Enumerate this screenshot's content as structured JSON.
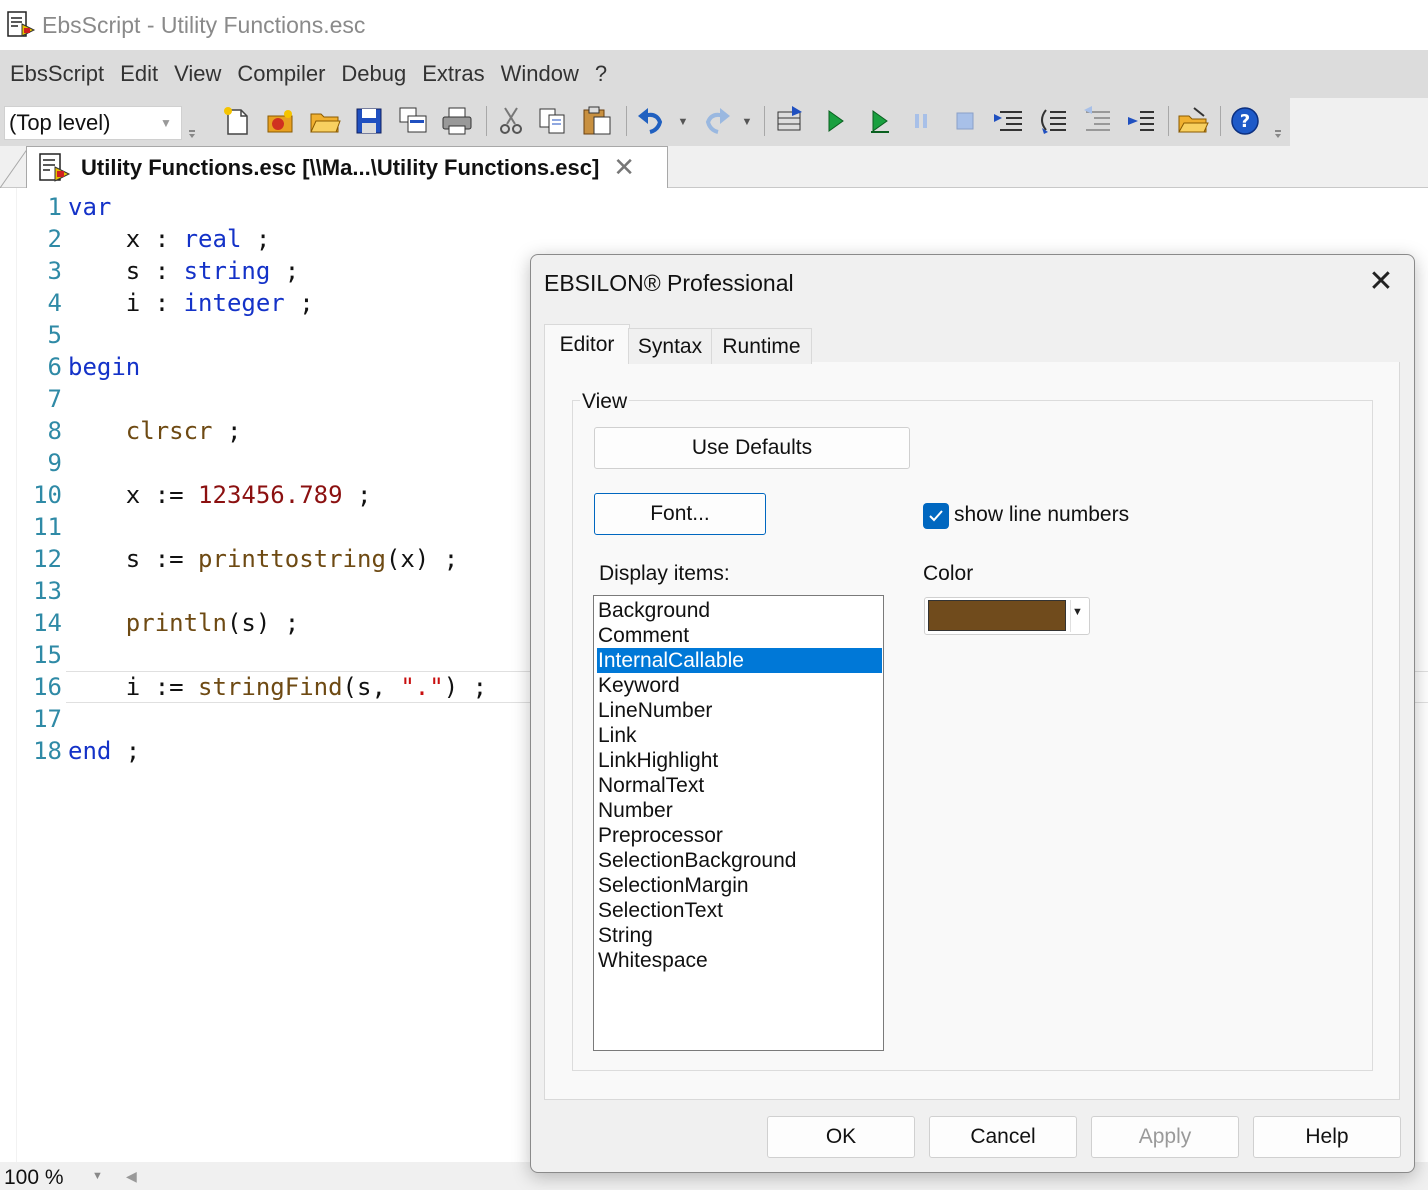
{
  "window": {
    "title": "EbsScript - Utility Functions.esc"
  },
  "menu": [
    "EbsScript",
    "Edit",
    "View",
    "Compiler",
    "Debug",
    "Extras",
    "Window",
    "?"
  ],
  "toolbar": {
    "scope_combo": "(Top level)",
    "icons": [
      "new-file-icon",
      "new-project-icon",
      "open-folder-icon",
      "save-icon",
      "save-all-icon",
      "print-icon",
      "cut-icon",
      "copy-icon",
      "paste-icon",
      "undo-icon",
      "redo-icon",
      "compile-icon",
      "run-icon",
      "run-step-icon",
      "pause-icon",
      "stop-icon",
      "step-into-icon",
      "step-over-icon",
      "step-out-icon",
      "run-to-cursor-icon",
      "open-project-icon",
      "help-icon"
    ]
  },
  "document_tab": {
    "label": "Utility Functions.esc [\\\\Ma...\\Utility Functions.esc]"
  },
  "code": [
    {
      "n": "1",
      "parts": [
        [
          "kw",
          "var"
        ]
      ]
    },
    {
      "n": "2",
      "parts": [
        [
          "",
          "    x : "
        ],
        [
          "kw",
          "real"
        ],
        [
          "",
          " ;"
        ]
      ]
    },
    {
      "n": "3",
      "parts": [
        [
          "",
          "    s : "
        ],
        [
          "kw",
          "string"
        ],
        [
          "",
          " ;"
        ]
      ]
    },
    {
      "n": "4",
      "parts": [
        [
          "",
          "    i : "
        ],
        [
          "kw",
          "integer"
        ],
        [
          "",
          " ;"
        ]
      ]
    },
    {
      "n": "5",
      "parts": []
    },
    {
      "n": "6",
      "parts": [
        [
          "kw",
          "begin"
        ]
      ]
    },
    {
      "n": "7",
      "parts": []
    },
    {
      "n": "8",
      "parts": [
        [
          "",
          "    "
        ],
        [
          "fn",
          "clrscr"
        ],
        [
          "",
          " ;"
        ]
      ]
    },
    {
      "n": "9",
      "parts": []
    },
    {
      "n": "10",
      "parts": [
        [
          "",
          "    x := "
        ],
        [
          "num",
          "123456.789"
        ],
        [
          "",
          " ;"
        ]
      ]
    },
    {
      "n": "11",
      "parts": []
    },
    {
      "n": "12",
      "parts": [
        [
          "",
          "    s := "
        ],
        [
          "fn",
          "printtostring"
        ],
        [
          "",
          "(x) ;"
        ]
      ]
    },
    {
      "n": "13",
      "parts": []
    },
    {
      "n": "14",
      "parts": [
        [
          "",
          "    "
        ],
        [
          "fn",
          "println"
        ],
        [
          "",
          "(s) ;"
        ]
      ]
    },
    {
      "n": "15",
      "parts": []
    },
    {
      "n": "16",
      "parts": [
        [
          "",
          "    i := "
        ],
        [
          "fn",
          "stringFind"
        ],
        [
          "",
          "(s, "
        ],
        [
          "str",
          "\".\""
        ],
        [
          "",
          ") ;"
        ]
      ]
    },
    {
      "n": "17",
      "parts": []
    },
    {
      "n": "18",
      "parts": [
        [
          "kw",
          "end"
        ],
        [
          "",
          " ;"
        ]
      ]
    }
  ],
  "status": {
    "zoom": "100 %"
  },
  "dialog": {
    "title": "EBSILON® Professional",
    "tabs": [
      "Editor",
      "Syntax",
      "Runtime"
    ],
    "active_tab": "Editor",
    "group_label": "View",
    "use_defaults": "Use Defaults",
    "font_button": "Font...",
    "show_line_numbers": {
      "label": "show line numbers",
      "checked": true
    },
    "display_items_label": "Display items:",
    "display_items": [
      "Background",
      "Comment",
      "InternalCallable",
      "Keyword",
      "LineNumber",
      "Link",
      "LinkHighlight",
      "NormalText",
      "Number",
      "Preprocessor",
      "SelectionBackground",
      "SelectionMargin",
      "SelectionText",
      "String",
      "Whitespace"
    ],
    "selected_item": "InternalCallable",
    "color_label": "Color",
    "color_value": "#704b1c",
    "buttons": {
      "ok": "OK",
      "cancel": "Cancel",
      "apply": "Apply",
      "help": "Help"
    }
  }
}
